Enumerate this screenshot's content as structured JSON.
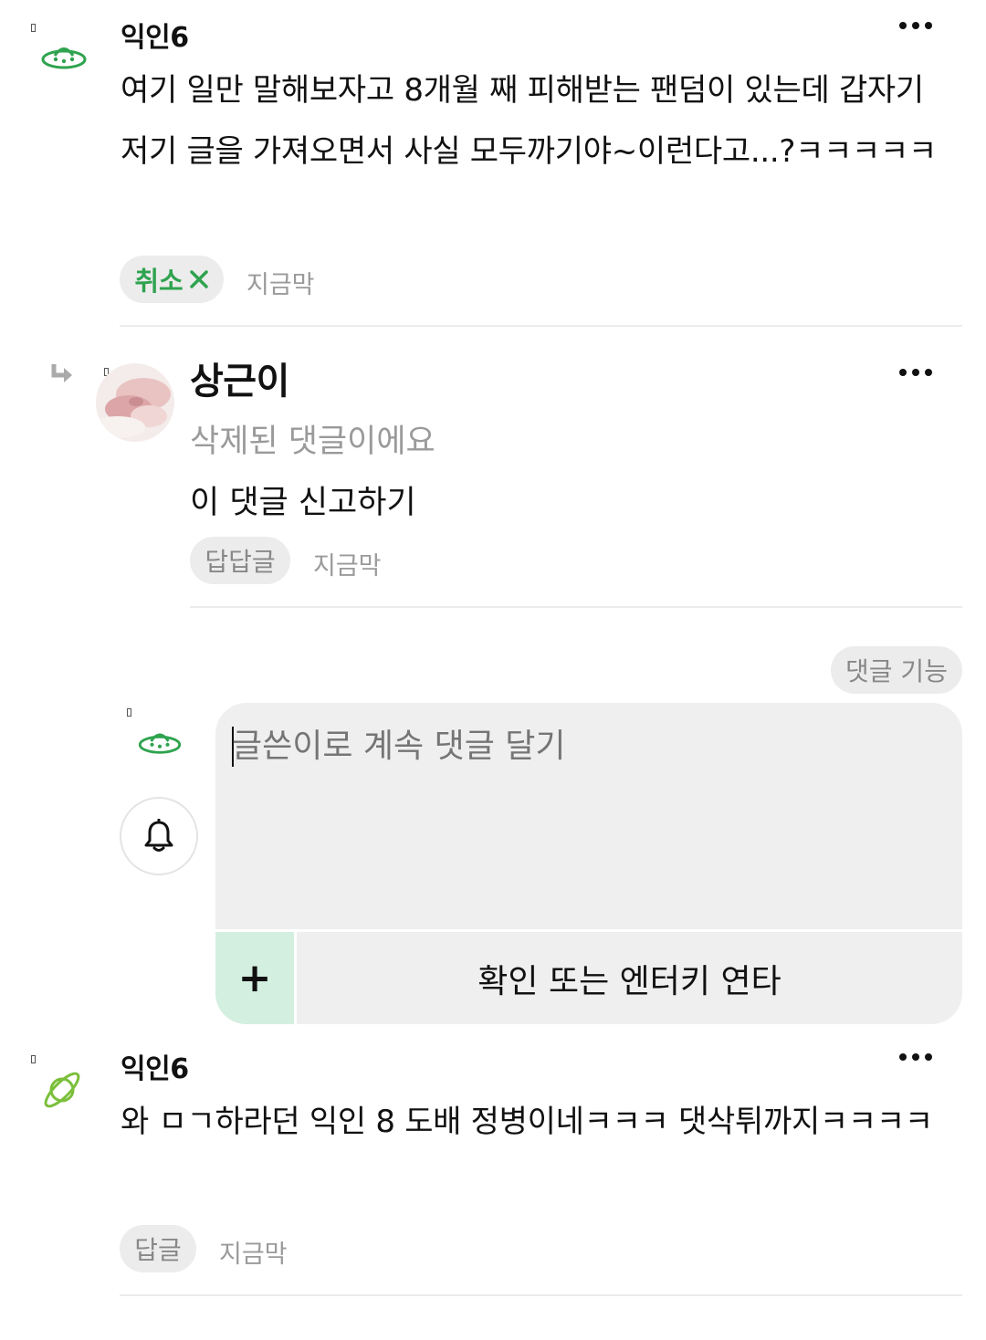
{
  "comment1": {
    "author": "익인6",
    "body": "여기 일만 말해보자고 8개월 째 피해받는 팬덤이 있는데 갑자기 저기 글을 가져오면서 사실 모두까기야~이런다고...?ㅋㅋㅋㅋㅋ",
    "cancel_label": "취소",
    "time": "지금막",
    "accent": "#2fa34f"
  },
  "reply1": {
    "author": "상근이",
    "deleted_text": "삭제된 댓글이에요",
    "report_link": "이 댓글 신고하기",
    "reply_label": "답답글",
    "time": "지금막"
  },
  "composer": {
    "features_label": "댓글 기능",
    "placeholder": "글쓴이로 계속 댓글 달기",
    "submit_label": "확인 또는 엔터키 연타",
    "plus_label": "+",
    "plus_bg": "#d3efe0"
  },
  "comment2": {
    "author": "익인6",
    "body": "와 ㅁㄱ하라던 익인 8 도배 정병이네ㅋㅋㅋ 댓삭튀까지ㅋㅋㅋㅋ",
    "reply_label": "답글",
    "time": "지금막",
    "icon_color": "#7bbf3a"
  }
}
